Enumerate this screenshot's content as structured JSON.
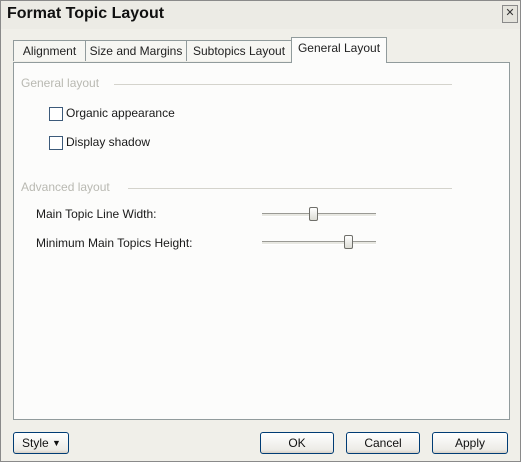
{
  "window": {
    "title": "Format Topic Layout",
    "close_glyph": "✕"
  },
  "tabs": [
    {
      "label": "Alignment",
      "active": false
    },
    {
      "label": "Size and Margins",
      "active": false
    },
    {
      "label": "Subtopics Layout",
      "active": false
    },
    {
      "label": "General Layout",
      "active": true
    }
  ],
  "general_layout": {
    "header": "General layout",
    "organic_appearance": {
      "label": "Organic appearance",
      "checked": false
    },
    "display_shadow": {
      "label": "Display shadow",
      "checked": false
    }
  },
  "advanced_layout": {
    "header": "Advanced layout",
    "main_topic_line_width": {
      "label": "Main Topic Line Width:",
      "value": 0.45
    },
    "minimum_main_topics_height": {
      "label": "Minimum Main Topics Height:",
      "value": 0.78
    }
  },
  "footer": {
    "style_label": "Style",
    "style_caret": "▼",
    "ok_label": "OK",
    "cancel_label": "Cancel",
    "apply_label": "Apply"
  }
}
